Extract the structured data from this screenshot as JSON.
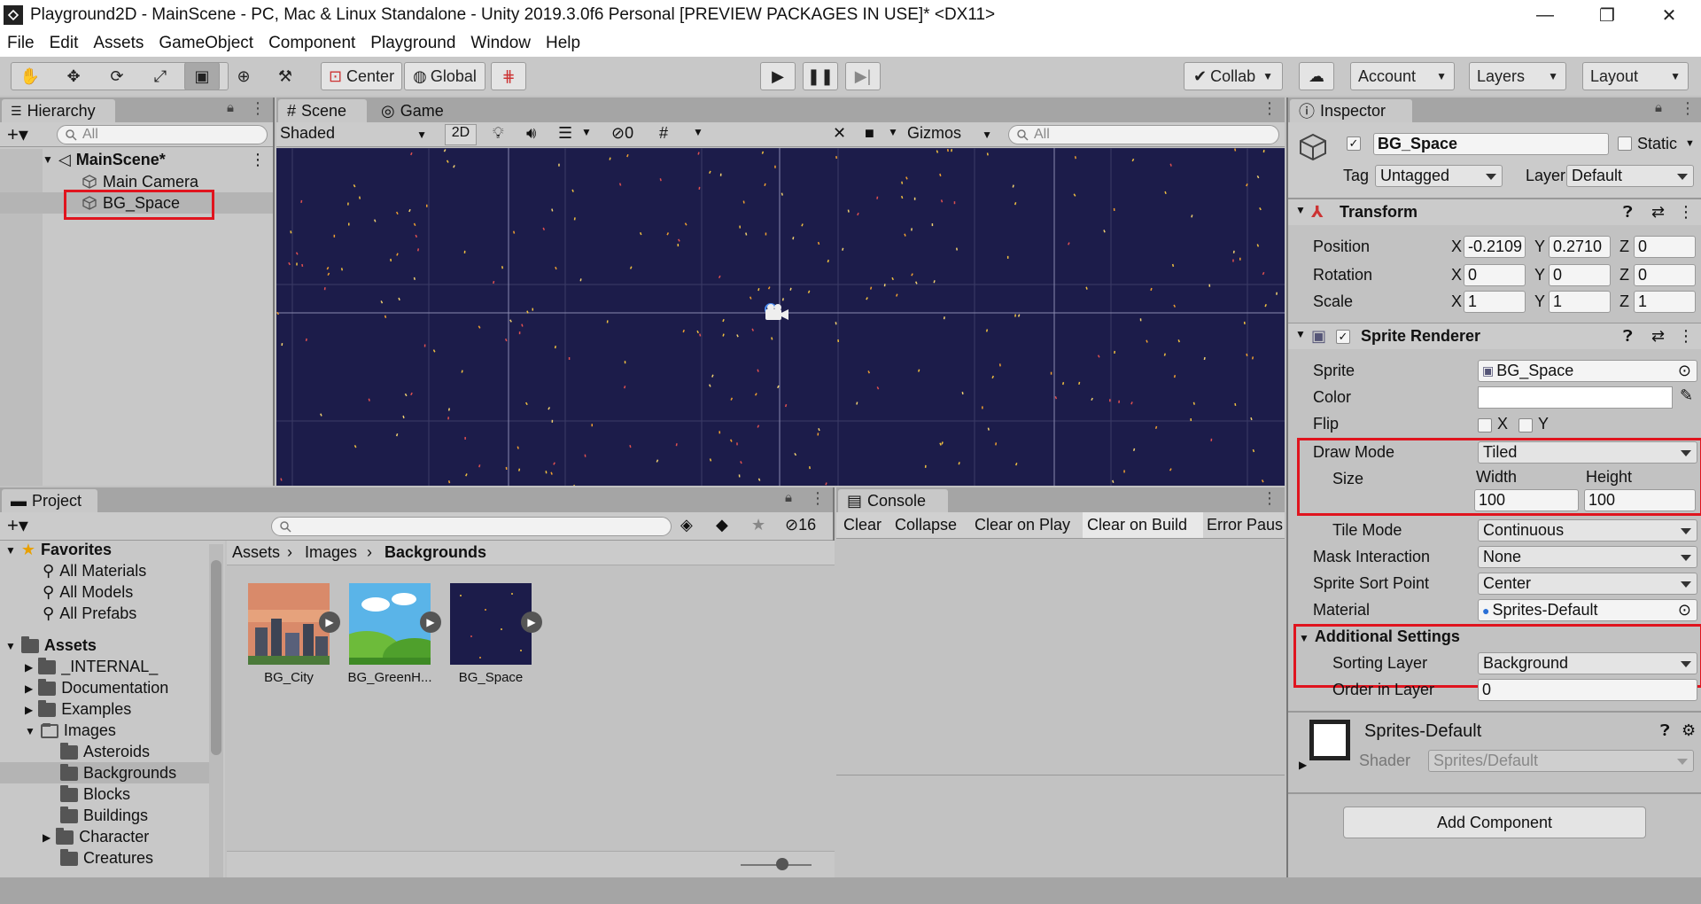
{
  "window": {
    "title": "Playground2D - MainScene - PC, Mac & Linux Standalone - Unity 2019.3.0f6 Personal [PREVIEW PACKAGES IN USE]* <DX11>",
    "minimize": "—",
    "maximize": "❐",
    "close": "✕"
  },
  "menu": [
    "File",
    "Edit",
    "Assets",
    "GameObject",
    "Component",
    "Playground",
    "Window",
    "Help"
  ],
  "toolbar": {
    "pivot": "Center",
    "space": "Global",
    "collab": "Collab",
    "account": "Account",
    "layers": "Layers",
    "layout": "Layout"
  },
  "hierarchy": {
    "tab": "Hierarchy",
    "search_placeholder": "All",
    "scene": "MainScene*",
    "items": [
      "Main Camera",
      "BG_Space"
    ]
  },
  "scene": {
    "tab_scene": "Scene",
    "tab_game": "Game",
    "shading": "Shaded",
    "mode2d": "2D",
    "hidden_count": "0",
    "gizmos": "Gizmos",
    "search_placeholder": "All"
  },
  "project": {
    "tab": "Project",
    "hidden_count": "16",
    "favorites_label": "Favorites",
    "favorites": [
      "All Materials",
      "All Models",
      "All Prefabs"
    ],
    "assets_label": "Assets",
    "folders": [
      "_INTERNAL_",
      "Documentation",
      "Examples",
      "Images"
    ],
    "image_subfolders": [
      "Asteroids",
      "Backgrounds",
      "Blocks",
      "Buildings",
      "Character",
      "Creatures"
    ],
    "breadcrumb": [
      "Assets",
      "Images",
      "Backgrounds"
    ],
    "assets": [
      "BG_City",
      "BG_GreenH...",
      "BG_Space"
    ]
  },
  "console": {
    "tab": "Console",
    "buttons": [
      "Clear",
      "Collapse",
      "Clear on Play",
      "Clear on Build",
      "Error Paus"
    ]
  },
  "inspector": {
    "tab": "Inspector",
    "object_name": "BG_Space",
    "static_label": "Static",
    "tag_label": "Tag",
    "tag_value": "Untagged",
    "layer_label": "Layer",
    "layer_value": "Default",
    "transform": {
      "title": "Transform",
      "position_label": "Position",
      "rotation_label": "Rotation",
      "scale_label": "Scale",
      "position": [
        "-0.2109",
        "0.2710",
        "0"
      ],
      "rotation": [
        "0",
        "0",
        "0"
      ],
      "scale": [
        "1",
        "1",
        "1"
      ],
      "axis": [
        "X",
        "Y",
        "Z"
      ]
    },
    "sprite_renderer": {
      "title": "Sprite Renderer",
      "sprite_label": "Sprite",
      "sprite_value": "BG_Space",
      "color_label": "Color",
      "flip_label": "Flip",
      "flip_x": "X",
      "flip_y": "Y",
      "draw_mode_label": "Draw Mode",
      "draw_mode_value": "Tiled",
      "size_label": "Size",
      "width_label": "Width",
      "height_label": "Height",
      "width_value": "100",
      "height_value": "100",
      "tile_mode_label": "Tile Mode",
      "tile_mode_value": "Continuous",
      "mask_label": "Mask Interaction",
      "mask_value": "None",
      "sort_point_label": "Sprite Sort Point",
      "sort_point_value": "Center",
      "material_label": "Material",
      "material_value": "Sprites-Default",
      "additional_label": "Additional Settings",
      "sorting_layer_label": "Sorting Layer",
      "sorting_layer_value": "Background",
      "order_label": "Order in Layer",
      "order_value": "0"
    },
    "material": {
      "name": "Sprites-Default",
      "shader_label": "Shader",
      "shader_value": "Sprites/Default"
    },
    "add_component": "Add Component"
  },
  "colors": {
    "scene_bg": "#1c1c4a",
    "highlight": "#e0141e"
  }
}
